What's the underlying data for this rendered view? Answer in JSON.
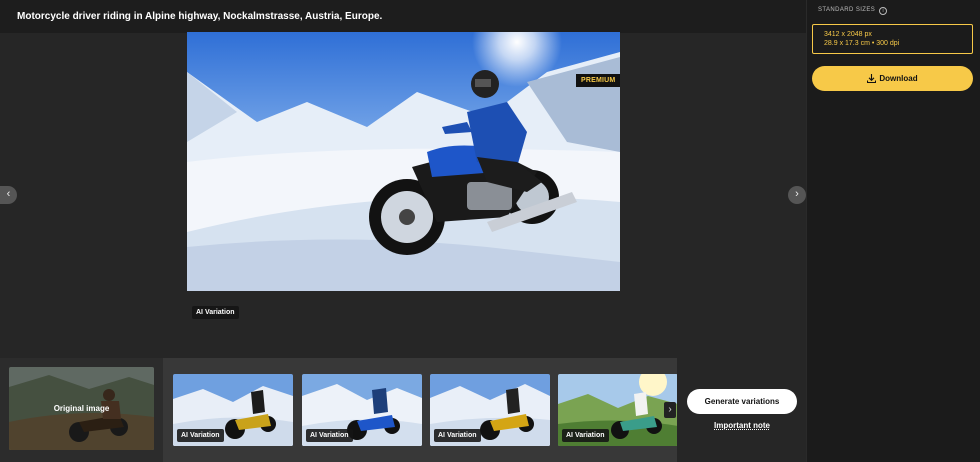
{
  "header": {
    "title": "Motorcycle driver riding in Alpine highway, Nockalmstrasse, Austria, Europe."
  },
  "viewer": {
    "premium_label": "PREMIUM",
    "badge_label": "AI Variation",
    "prev_icon": "chevron-left-icon",
    "next_icon": "chevron-right-icon",
    "prev_glyph": "‹",
    "next_glyph": "›"
  },
  "variations": {
    "original_label": "Original image",
    "items": [
      {
        "label": "AI Variation"
      },
      {
        "label": "AI Variation"
      },
      {
        "label": "AI Variation"
      },
      {
        "label": "AI Variation"
      }
    ],
    "next_glyph": "›",
    "generate_label": "Generate variations",
    "important_note": "Important note"
  },
  "sidebar": {
    "sizes_label": "STANDARD SIZES",
    "info_glyph": "i",
    "size_px": "3412 x 2048 px",
    "size_cm": "28.9 x 17.3 cm • 300 dpi",
    "download_label": "Download"
  },
  "colors": {
    "accent": "#f7c948",
    "background": "#262626",
    "sidebar": "#1b1b1b"
  }
}
